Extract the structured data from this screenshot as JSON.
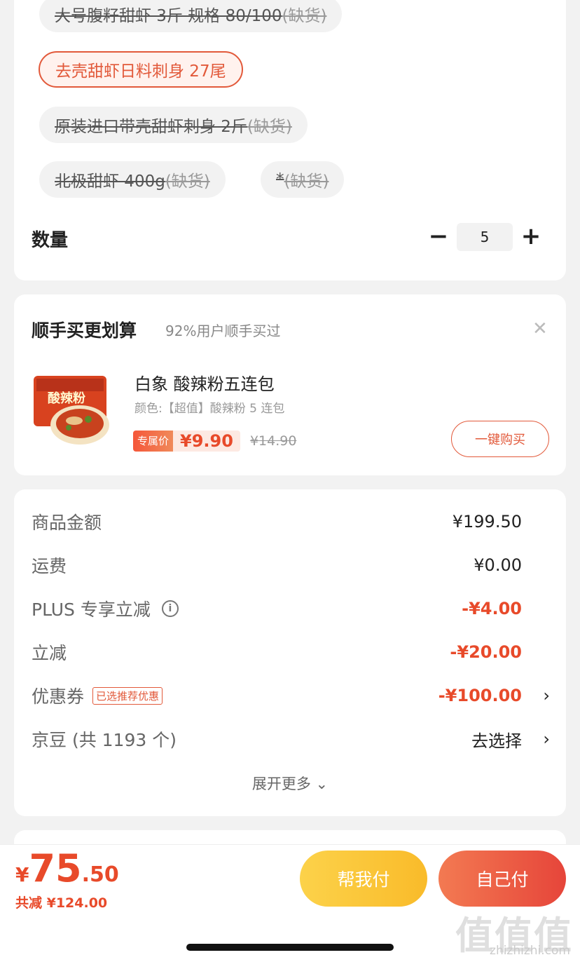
{
  "spec": {
    "chips": [
      {
        "name": "大号腹籽甜虾 3斤 规格 80/100",
        "tag": "(缺货)",
        "state": "oos"
      },
      {
        "name": "去壳甜虾日料刺身 27尾",
        "tag": "",
        "state": "selected"
      },
      {
        "name": "原装进口带壳甜虾刺身 2斤",
        "tag": "(缺货)",
        "state": "oos"
      },
      {
        "name": "北极甜虾 400g",
        "tag": "(缺货)",
        "state": "oos"
      },
      {
        "name": "*",
        "tag": "(缺货)",
        "state": "oos"
      }
    ],
    "quantity_label": "数量",
    "quantity_value": "5",
    "minus": "−",
    "plus": "+"
  },
  "recommend": {
    "title": "顺手买更划算",
    "subtitle": "92%用户顺手买过",
    "close": "✕",
    "product_name": "白象 酸辣粉五连包",
    "product_spec": "颜色:【超值】酸辣粉 5 连包",
    "price_tag": "专属价",
    "price": "¥9.90",
    "original_price": "¥14.90",
    "buy_button": "一键购买",
    "image_text": "酸辣粉"
  },
  "summary": {
    "goods_label": "商品金额",
    "goods_value": "¥199.50",
    "shipping_label": "运费",
    "shipping_value": "¥0.00",
    "plus_label": "PLUS 专享立减",
    "plus_value": "-¥4.00",
    "discount_label": "立减",
    "discount_value": "-¥20.00",
    "coupon_label": "优惠券",
    "coupon_badge": "已选推荐优惠",
    "coupon_value": "-¥100.00",
    "jingdou_label": "京豆 (共 1193 个)",
    "jingdou_value": "去选择",
    "expand": "展开更多 ⌄"
  },
  "bottom": {
    "currency": "¥",
    "total_int": "75",
    "total_dec": ".50",
    "saved": "共减 ¥124.00",
    "help_pay": "帮我付",
    "self_pay": "自己付"
  },
  "watermark": {
    "logo": "值值值",
    "url": "zhizhizhi.com"
  },
  "colors": {
    "accent": "#e84a2a",
    "help_button": "#f9bb2a",
    "pay_button": "#e6453a"
  }
}
